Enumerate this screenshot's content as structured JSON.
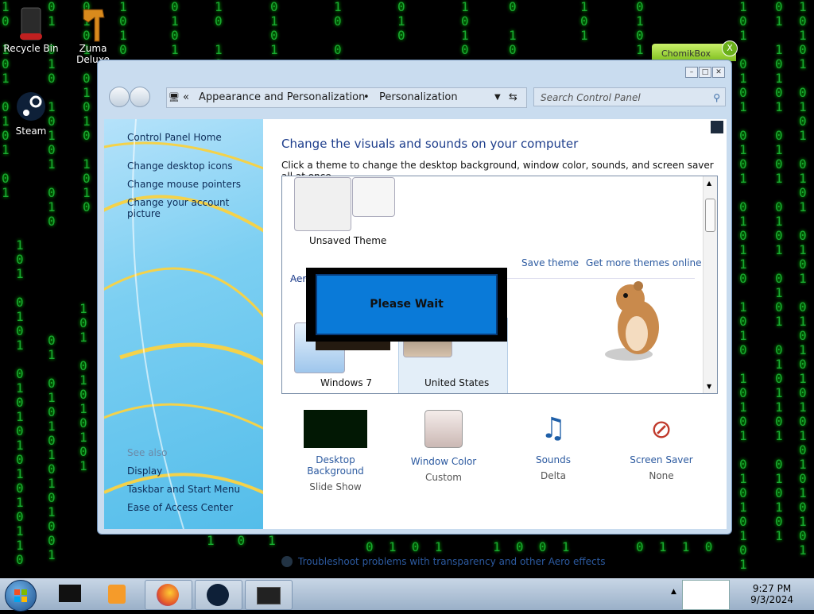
{
  "desktop": {
    "icons": [
      {
        "label": "Recycle Bin",
        "icon": "recycle-bin-icon"
      },
      {
        "label": "Zuma Deluxe",
        "icon": "zuma-icon"
      },
      {
        "label": "Steam",
        "icon": "steam-icon"
      }
    ],
    "chomikbox": {
      "label": "ChomikBox",
      "close": "X"
    }
  },
  "window": {
    "address": {
      "crumb1": "Appearance and Personalization",
      "separator": "•",
      "crumb2": "Personalization",
      "chevrons": "«"
    },
    "search_placeholder": "Search Control Panel",
    "left": {
      "home": "Control Panel Home",
      "links": [
        "Change desktop icons",
        "Change mouse pointers",
        "Change your account picture"
      ],
      "see_also": "See also",
      "see_links": [
        "Display",
        "Taskbar and Start Menu",
        "Ease of Access Center"
      ]
    },
    "main": {
      "title": "Change the visuals and sounds on your computer",
      "subtitle": "Click a theme to change the desktop background, window color, sounds, and screen saver all at once.",
      "unsaved_theme": "Unsaved Theme",
      "save_theme": "Save theme",
      "get_more": "Get more themes online",
      "aero_partial": "Aero",
      "theme1": "Windows 7",
      "theme2": "United States",
      "please_wait": "Please Wait"
    },
    "bottom": [
      {
        "label": "Desktop Background",
        "value": "Slide Show"
      },
      {
        "label": "Window Color",
        "value": "Custom"
      },
      {
        "label": "Sounds",
        "value": "Delta"
      },
      {
        "label": "Screen Saver",
        "value": "None"
      }
    ],
    "troubleshoot": "Troubleshoot problems with transparency and other Aero effects"
  },
  "taskbar": {
    "time": "9:27 PM",
    "date": "9/3/2024"
  },
  "colors": {
    "accent": "#1e3e8c",
    "link": "#2c5aa0",
    "matrix": "#1ec93a"
  }
}
